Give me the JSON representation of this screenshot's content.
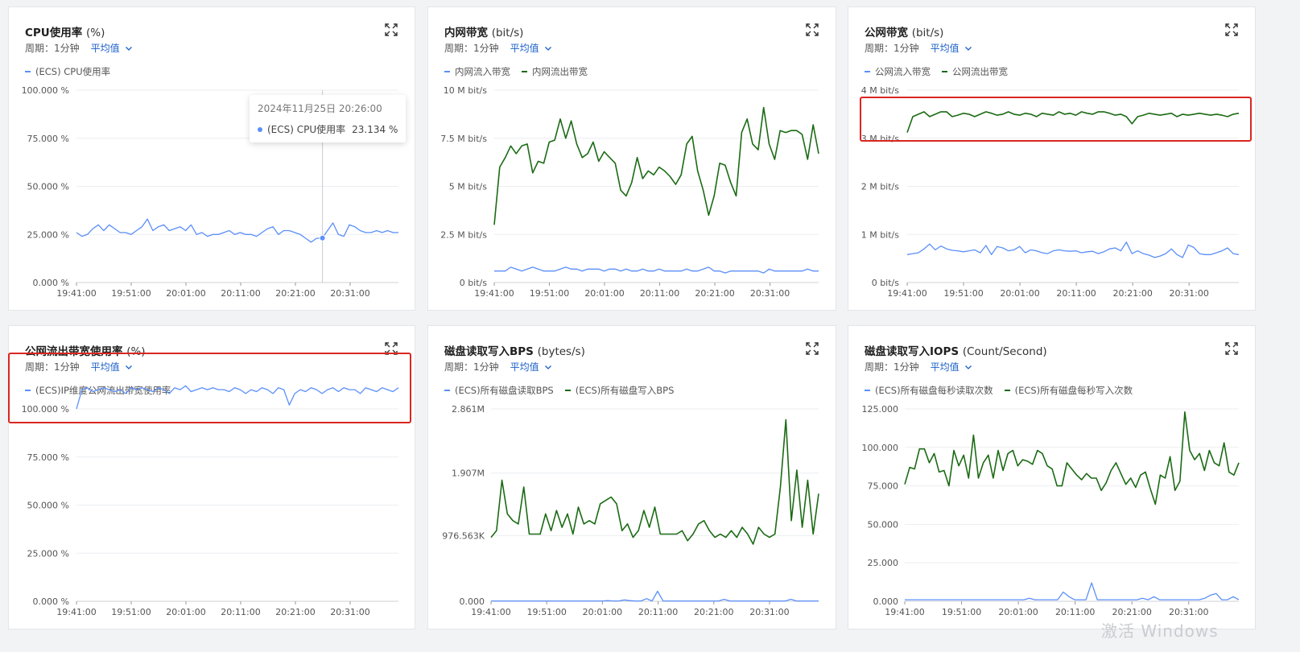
{
  "period_label": "周期：1分钟",
  "aggregation": "平均值",
  "x_ticks": [
    "19:41:00",
    "19:51:00",
    "20:01:00",
    "20:11:00",
    "20:21:00",
    "20:31:00"
  ],
  "colors": {
    "series_blue": "#5b8ff9",
    "series_green": "#1b6b14",
    "highlight": "#d9271f",
    "link": "#1a5fc9"
  },
  "icons": {
    "expand": "expand-arrows-icon",
    "chevron": "chevron-down-icon"
  },
  "panels": [
    {
      "title": "CPU使用率",
      "unit": "(%)",
      "legend": [
        {
          "name": "(ECS) CPU使用率",
          "color": "#5b8ff9"
        }
      ],
      "tooltip": {
        "date": "2024年11月25日 20:26:00",
        "series": "(ECS) CPU使用率",
        "value": "23.134 %"
      },
      "chart_data": {
        "type": "line",
        "y_ticks": [
          "100.000 %",
          "75.000 %",
          "50.000 %",
          "25.000 %",
          "0.000 %"
        ],
        "ylim": [
          0,
          100
        ],
        "x_range": [
          "19:41:00",
          "20:40:00"
        ],
        "series": [
          {
            "name": "(ECS) CPU使用率",
            "color": "#5b8ff9",
            "values": [
              26,
              24,
              25,
              28,
              30,
              27,
              30,
              28,
              26,
              26,
              25,
              27,
              29,
              33,
              27,
              29,
              30,
              27,
              28,
              29,
              27,
              30,
              25,
              26,
              24,
              25,
              25,
              26,
              27,
              25,
              26,
              25,
              25,
              24,
              26,
              28,
              29,
              25,
              27,
              27,
              26,
              25,
              23,
              21,
              23,
              23,
              27,
              31,
              25,
              24,
              30,
              29,
              27,
              26,
              26,
              27,
              26,
              27,
              26,
              26
            ]
          }
        ]
      }
    },
    {
      "title": "内网带宽",
      "unit": "(bit/s)",
      "legend": [
        {
          "name": "内网流入带宽",
          "color": "#5b8ff9"
        },
        {
          "name": "内网流出带宽",
          "color": "#1b6b14"
        }
      ],
      "chart_data": {
        "type": "line",
        "y_ticks": [
          "10 M bit/s",
          "7.5 M bit/s",
          "5 M bit/s",
          "2.5 M bit/s",
          "0  bit/s"
        ],
        "ylim": [
          0,
          10
        ],
        "x_range": [
          "19:41:00",
          "20:40:00"
        ],
        "series": [
          {
            "name": "内网流入带宽",
            "color": "#5b8ff9",
            "values": [
              0.6,
              0.6,
              0.6,
              0.8,
              0.7,
              0.6,
              0.7,
              0.8,
              0.7,
              0.6,
              0.6,
              0.6,
              0.7,
              0.8,
              0.7,
              0.7,
              0.6,
              0.7,
              0.7,
              0.7,
              0.6,
              0.7,
              0.7,
              0.6,
              0.7,
              0.6,
              0.6,
              0.7,
              0.6,
              0.6,
              0.7,
              0.6,
              0.6,
              0.6,
              0.6,
              0.7,
              0.6,
              0.6,
              0.7,
              0.8,
              0.6,
              0.6,
              0.5,
              0.6,
              0.6,
              0.6,
              0.6,
              0.6,
              0.6,
              0.5,
              0.7,
              0.6,
              0.6,
              0.6,
              0.6,
              0.6,
              0.6,
              0.7,
              0.6,
              0.6
            ]
          },
          {
            "name": "内网流出带宽",
            "color": "#1b6b14",
            "values": [
              3.0,
              6.0,
              6.5,
              7.1,
              6.7,
              7.1,
              7.2,
              5.7,
              6.3,
              6.2,
              7.3,
              7.4,
              8.5,
              7.5,
              8.4,
              7.2,
              6.5,
              6.7,
              7.3,
              6.3,
              6.8,
              6.5,
              6.2,
              4.8,
              4.5,
              5.2,
              6.5,
              5.4,
              5.8,
              5.6,
              6.0,
              5.8,
              5.5,
              5.1,
              5.6,
              7.2,
              7.6,
              5.8,
              4.8,
              3.5,
              4.5,
              6.2,
              6.1,
              5.2,
              4.5,
              7.8,
              8.5,
              7.2,
              6.9,
              9.1,
              7.2,
              6.4,
              7.9,
              7.8,
              7.9,
              7.9,
              7.7,
              6.4,
              8.2,
              6.7
            ]
          }
        ]
      }
    },
    {
      "title": "公网带宽",
      "unit": "(bit/s)",
      "legend": [
        {
          "name": "公网流入带宽",
          "color": "#5b8ff9"
        },
        {
          "name": "公网流出带宽",
          "color": "#1b6b14"
        }
      ],
      "chart_data": {
        "type": "line",
        "y_ticks": [
          "4 M bit/s",
          "3 M bit/s",
          "2 M bit/s",
          "1 M bit/s",
          "0  bit/s"
        ],
        "ylim": [
          0,
          4
        ],
        "x_range": [
          "19:41:00",
          "20:40:00"
        ],
        "series": [
          {
            "name": "公网流入带宽",
            "color": "#5b8ff9",
            "values": [
              0.58,
              0.6,
              0.62,
              0.7,
              0.8,
              0.68,
              0.76,
              0.7,
              0.67,
              0.66,
              0.64,
              0.66,
              0.68,
              0.62,
              0.77,
              0.58,
              0.75,
              0.72,
              0.66,
              0.68,
              0.75,
              0.62,
              0.68,
              0.66,
              0.62,
              0.6,
              0.66,
              0.68,
              0.66,
              0.65,
              0.66,
              0.62,
              0.64,
              0.65,
              0.6,
              0.64,
              0.7,
              0.72,
              0.66,
              0.84,
              0.6,
              0.66,
              0.6,
              0.57,
              0.52,
              0.55,
              0.6,
              0.7,
              0.58,
              0.52,
              0.78,
              0.73,
              0.6,
              0.58,
              0.58,
              0.62,
              0.66,
              0.72,
              0.6,
              0.58
            ]
          },
          {
            "name": "公网流出带宽",
            "color": "#1b6b14",
            "values": [
              3.12,
              3.45,
              3.5,
              3.55,
              3.45,
              3.5,
              3.55,
              3.55,
              3.45,
              3.48,
              3.52,
              3.5,
              3.45,
              3.5,
              3.55,
              3.52,
              3.48,
              3.5,
              3.55,
              3.5,
              3.48,
              3.52,
              3.5,
              3.45,
              3.52,
              3.5,
              3.48,
              3.55,
              3.5,
              3.52,
              3.48,
              3.55,
              3.52,
              3.5,
              3.55,
              3.55,
              3.52,
              3.48,
              3.5,
              3.45,
              3.3,
              3.45,
              3.48,
              3.52,
              3.5,
              3.48,
              3.5,
              3.52,
              3.45,
              3.5,
              3.48,
              3.5,
              3.52,
              3.5,
              3.48,
              3.5,
              3.48,
              3.45,
              3.5,
              3.52
            ]
          }
        ]
      }
    },
    {
      "title": "公网流出带宽使用率",
      "unit": "(%)",
      "legend": [
        {
          "name": "(ECS)IP维度公网流出带宽使用率",
          "color": "#5b8ff9"
        }
      ],
      "chart_data": {
        "type": "line",
        "y_ticks": [
          "100.000 %",
          "75.000 %",
          "50.000 %",
          "25.000 %",
          "0.000 %"
        ],
        "ylim": [
          0,
          100
        ],
        "x_range": [
          "19:41:00",
          "20:40:00"
        ],
        "series": [
          {
            "name": "(ECS)IP维度公网流出带宽使用率",
            "color": "#5b8ff9",
            "values": [
              100,
              110,
              111,
              109,
              110,
              111,
              110,
              109,
              110,
              108,
              111,
              110,
              111,
              110,
              109,
              111,
              110,
              108,
              111,
              110,
              112,
              109,
              110,
              111,
              110,
              111,
              110,
              110,
              109,
              111,
              110,
              108,
              110,
              109,
              111,
              110,
              108,
              111,
              110,
              102,
              108,
              110,
              109,
              111,
              110,
              108,
              110,
              111,
              109,
              111,
              110,
              110,
              108,
              111,
              110,
              109,
              111,
              110,
              109,
              111
            ]
          }
        ]
      }
    },
    {
      "title": "磁盘读取写入BPS",
      "unit": "(bytes/s)",
      "legend": [
        {
          "name": "(ECS)所有磁盘读取BPS",
          "color": "#5b8ff9"
        },
        {
          "name": "(ECS)所有磁盘写入BPS",
          "color": "#1b6b14"
        }
      ],
      "chart_data": {
        "type": "line",
        "y_ticks": [
          "2.861M",
          "1.907M",
          "976.563K",
          "0.000"
        ],
        "y_tick_values": [
          2861,
          1907,
          976.563,
          0
        ],
        "ylim": [
          0,
          2861
        ],
        "x_range": [
          "19:41:00",
          "20:40:00"
        ],
        "series": [
          {
            "name": "(ECS)所有磁盘读取BPS",
            "color": "#5b8ff9",
            "values": [
              5,
              5,
              5,
              5,
              5,
              5,
              5,
              5,
              5,
              5,
              5,
              5,
              5,
              5,
              5,
              5,
              5,
              5,
              5,
              5,
              5,
              10,
              5,
              5,
              20,
              10,
              5,
              5,
              40,
              5,
              150,
              5,
              5,
              5,
              5,
              5,
              5,
              5,
              5,
              5,
              5,
              5,
              30,
              5,
              5,
              5,
              5,
              5,
              5,
              5,
              5,
              5,
              5,
              5,
              30,
              5,
              5,
              5,
              5,
              5
            ]
          },
          {
            "name": "(ECS)所有磁盘写入BPS",
            "color": "#1b6b14",
            "values": [
              950,
              1050,
              1800,
              1300,
              1200,
              1150,
              1700,
              1000,
              1000,
              1000,
              1300,
              1050,
              1350,
              1100,
              1300,
              1000,
              1400,
              1150,
              1200,
              1150,
              1450,
              1500,
              1550,
              1450,
              1050,
              1150,
              950,
              1050,
              1350,
              1100,
              1400,
              1000,
              1000,
              1000,
              1000,
              1050,
              900,
              1000,
              1150,
              1200,
              1050,
              950,
              1000,
              950,
              1050,
              950,
              1100,
              1000,
              850,
              1100,
              1000,
              950,
              1000,
              1700,
              2700,
              1200,
              1950,
              1100,
              1800,
              1000,
              1600
            ]
          }
        ]
      }
    },
    {
      "title": "磁盘读取写入IOPS",
      "unit": "(Count/Second)",
      "legend": [
        {
          "name": "(ECS)所有磁盘每秒读取次数",
          "color": "#5b8ff9"
        },
        {
          "name": "(ECS)所有磁盘每秒写入次数",
          "color": "#1b6b14"
        }
      ],
      "chart_data": {
        "type": "line",
        "y_ticks": [
          "125.000",
          "100.000",
          "75.000",
          "50.000",
          "25.000",
          "0.000"
        ],
        "ylim": [
          0,
          125
        ],
        "x_range": [
          "19:41:00",
          "20:40:00"
        ],
        "series": [
          {
            "name": "(ECS)所有磁盘每秒读取次数",
            "color": "#5b8ff9",
            "values": [
              1,
              1,
              1,
              1,
              1,
              1,
              1,
              1,
              1,
              1,
              1,
              1,
              1,
              1,
              1,
              1,
              1,
              1,
              1,
              1,
              1,
              1,
              2,
              1,
              1,
              1,
              1,
              1,
              6,
              3,
              1,
              1,
              1,
              12,
              1,
              1,
              1,
              1,
              1,
              1,
              1,
              1,
              2,
              1,
              3,
              1,
              1,
              1,
              1,
              1,
              1,
              1,
              1,
              2,
              4,
              5,
              1,
              1,
              3,
              1
            ]
          },
          {
            "name": "(ECS)所有磁盘每秒写入次数",
            "color": "#1b6b14",
            "values": [
              76,
              87,
              86,
              99,
              99,
              90,
              96,
              84,
              85,
              75,
              98,
              88,
              95,
              80,
              108,
              80,
              90,
              95,
              80,
              98,
              85,
              96,
              98,
              88,
              92,
              91,
              89,
              98,
              96,
              88,
              86,
              75,
              75,
              90,
              86,
              82,
              79,
              83,
              80,
              80,
              72,
              77,
              85,
              90,
              83,
              76,
              80,
              74,
              82,
              84,
              73,
              63,
              82,
              80,
              94,
              72,
              78,
              123,
              98,
              92,
              96,
              85,
              98,
              90,
              88,
              103,
              84,
              82,
              90
            ]
          }
        ]
      }
    }
  ],
  "watermark": "激活 Windows"
}
